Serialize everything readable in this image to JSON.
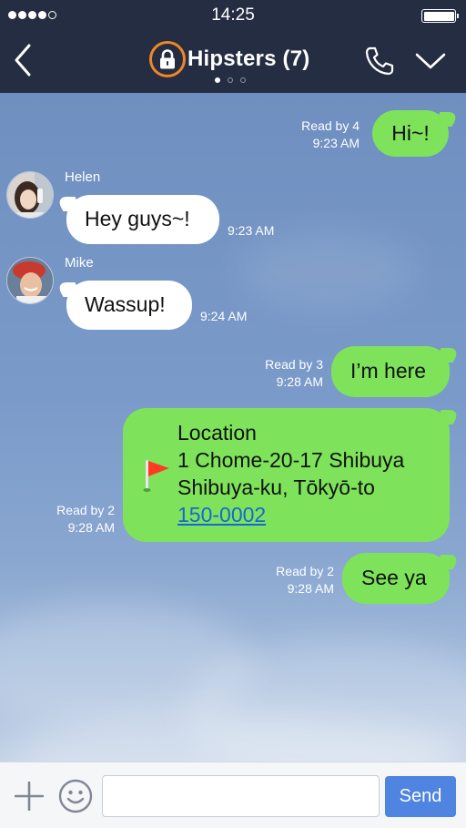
{
  "status_bar": {
    "time": "14:25",
    "signal_bars": 4,
    "signal_total": 5,
    "battery_level": 1.0
  },
  "header": {
    "title": "Hipsters (7)",
    "page_indicator": {
      "count": 3,
      "active": 1
    },
    "icons": {
      "back": "chevron-left-icon",
      "lock": "lock-icon",
      "call": "phone-icon",
      "menu": "chevron-down-icon"
    },
    "colors": {
      "background": "#252d42",
      "lock_highlight": "#f08626"
    }
  },
  "messages": [
    {
      "direction": "outgoing",
      "text": "Hi~!",
      "read_status": "Read by 4",
      "time": "9:23 AM"
    },
    {
      "direction": "incoming",
      "sender": "Helen",
      "text": "Hey guys~!",
      "time": "9:23 AM"
    },
    {
      "direction": "incoming",
      "sender": "Mike",
      "text": "Wassup!",
      "time": "9:24 AM"
    },
    {
      "direction": "outgoing",
      "text": "I’m here",
      "read_status": "Read by 3",
      "time": "9:28 AM"
    },
    {
      "direction": "outgoing",
      "type": "location",
      "title": "Location",
      "address_line1": "1 Chome-20-17 Shibuya",
      "address_line2": "Shibuya-ku, Tōkyō-to",
      "postal_code": "150-0002",
      "read_status": "Read by 2",
      "time": "9:28 AM"
    },
    {
      "direction": "outgoing",
      "text": "See ya",
      "read_status": "Read by 2",
      "time": "9:28 AM"
    }
  ],
  "input_bar": {
    "placeholder": "",
    "value": "",
    "send_label": "Send",
    "icons": {
      "attach": "plus-icon",
      "sticker": "smiley-icon"
    }
  },
  "colors": {
    "outgoing_bubble": "#7ee35a",
    "incoming_bubble": "#ffffff",
    "send_button": "#4f84e0",
    "link": "#1667d8"
  }
}
